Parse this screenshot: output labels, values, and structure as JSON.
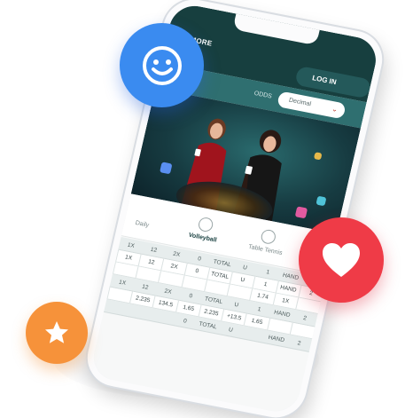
{
  "topbar": {
    "more_label": "MORE",
    "login_label": "LOG IN"
  },
  "odds": {
    "label": "ODDS",
    "selected": "Decimal"
  },
  "sports": [
    {
      "label": "Daily"
    },
    {
      "label": "Volleyball"
    },
    {
      "label": "Table Tennis"
    }
  ],
  "odds_grid": {
    "header_row_1": [
      "1X",
      "12",
      "2X",
      "0",
      "TOTAL",
      "U",
      "1",
      "HAND",
      "2"
    ],
    "row_1": [
      "1X",
      "12",
      "2X",
      "0",
      "TOTAL",
      "U",
      "1",
      "HAND",
      "2"
    ],
    "row_2": [
      "",
      "",
      "",
      "",
      "",
      "",
      "1.74",
      "1X",
      ""
    ],
    "row_3": [
      "1X",
      "12",
      "2X",
      "0",
      "TOTAL",
      "U",
      "1",
      "HAND",
      "2"
    ],
    "row_4": [
      "",
      "2.235",
      "134.5",
      "1.65",
      "2.235",
      "+13.5",
      "1.65",
      "",
      ""
    ],
    "row_5": [
      "",
      "",
      "",
      "0",
      "TOTAL",
      "U",
      "",
      "HAND",
      "2"
    ]
  },
  "colors": {
    "brand_dark": "#173f3f",
    "brand_mid": "#2f6f70",
    "smile_badge": "#3a8bf0",
    "heart_badge": "#ef3b47",
    "star_badge": "#f6923a"
  },
  "icons": [
    "smile-icon",
    "heart-icon",
    "star-icon",
    "volleyball-icon",
    "table-tennis-icon",
    "chevron-down-icon"
  ]
}
